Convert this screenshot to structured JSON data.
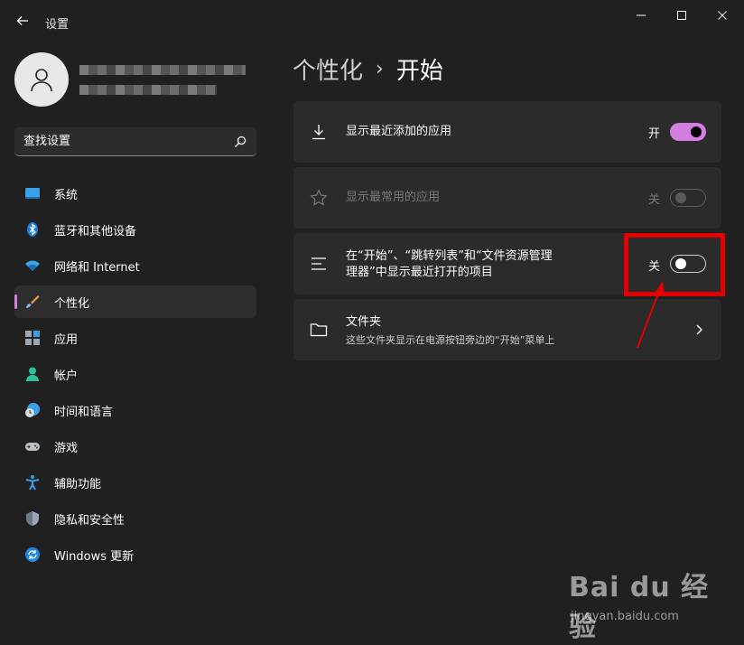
{
  "window": {
    "title": "设置",
    "back_icon": "back-arrow-icon",
    "controls": [
      "minimize-icon",
      "maximize-icon",
      "close-icon"
    ]
  },
  "search": {
    "placeholder": "查找设置",
    "icon": "search-icon"
  },
  "sidebar": {
    "items": [
      {
        "label": "系统",
        "icon": "system-display-icon",
        "active": false
      },
      {
        "label": "蓝牙和其他设备",
        "icon": "bluetooth-icon",
        "active": false
      },
      {
        "label": "网络和 Internet",
        "icon": "wifi-icon",
        "active": false
      },
      {
        "label": "个性化",
        "icon": "brush-icon",
        "active": true
      },
      {
        "label": "应用",
        "icon": "apps-icon",
        "active": false
      },
      {
        "label": "帐户",
        "icon": "person-icon",
        "active": false
      },
      {
        "label": "时间和语言",
        "icon": "globe-clock-icon",
        "active": false
      },
      {
        "label": "游戏",
        "icon": "gamepad-icon",
        "active": false
      },
      {
        "label": "辅助功能",
        "icon": "accessibility-icon",
        "active": false
      },
      {
        "label": "隐私和安全性",
        "icon": "shield-icon",
        "active": false
      },
      {
        "label": "Windows 更新",
        "icon": "update-icon",
        "active": false
      }
    ]
  },
  "breadcrumb": {
    "parent": "个性化",
    "separator": "›",
    "current": "开始"
  },
  "settings": {
    "recent_apps": {
      "title": "显示最近添加的应用",
      "state": "开",
      "on": true,
      "icon": "download-icon"
    },
    "most_used": {
      "title": "显示最常用的应用",
      "state": "关",
      "on": false,
      "disabled": true,
      "icon": "star-icon"
    },
    "recent_items": {
      "title_line1": "在“开始”、“跳转列表”和“文件资源管理",
      "title_line2": "理器”中显示最近打开的项目",
      "state": "关",
      "on": false,
      "icon": "list-lines-icon"
    },
    "folders": {
      "title": "文件夹",
      "subtitle": "这些文件夹显示在电源按钮旁边的“开始”菜单上",
      "icon": "folder-icon",
      "chevron": "chevron-right-icon"
    }
  },
  "colors": {
    "accent": "#d37fe0",
    "background": "#202020",
    "card": "#2b2b2b",
    "highlight": "#e30000"
  },
  "watermark": {
    "logo": "Bai du 经验",
    "url": "jingyan.baidu.com"
  }
}
